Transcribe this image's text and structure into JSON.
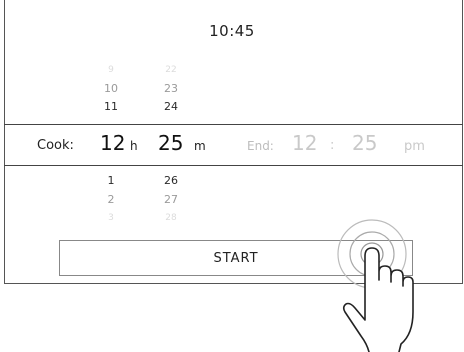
{
  "status": {
    "time": "10:45"
  },
  "hour_wheel": {
    "above": [
      "9",
      "10",
      "11"
    ],
    "below": [
      "1",
      "2",
      "3"
    ]
  },
  "minute_wheel": {
    "above": [
      "22",
      "23",
      "24"
    ],
    "below": [
      "26",
      "27",
      "28"
    ]
  },
  "cook": {
    "label": "Cook:",
    "hours": "12",
    "hours_unit": "h",
    "minutes": "25",
    "minutes_unit": "m"
  },
  "end": {
    "label": "End:",
    "hours": "12",
    "separator": ":",
    "minutes": "25",
    "period": "pm"
  },
  "start_button": {
    "label": "START"
  },
  "icons": {
    "gesture": "tap-hand-icon"
  }
}
